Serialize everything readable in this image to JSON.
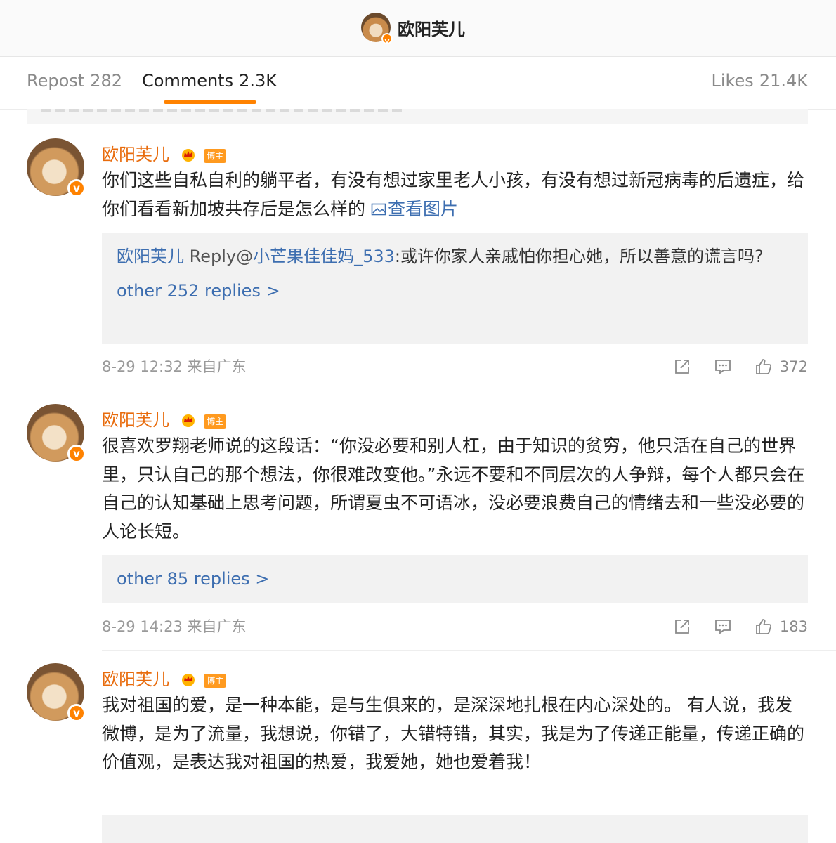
{
  "header": {
    "title": "欧阳芙儿"
  },
  "tabs": {
    "repost_label": "Repost",
    "repost_count": "282",
    "comments_label": "Comments",
    "comments_count": "2.3K",
    "likes_label": "Likes",
    "likes_count": "21.4K"
  },
  "colors": {
    "accent": "#ff8200",
    "username": "#e86b0c",
    "link": "#3d6eb0"
  },
  "badges": {
    "host": "博主"
  },
  "comments": [
    {
      "author": "欧阳芙儿",
      "text": "你们这些自私自利的躺平者，有没有想过家里老人小孩，有没有想过新冠病毒的后遗症，给你们看看新加坡共存后是怎么样的",
      "view_picture": "查看图片",
      "reply": {
        "author": "欧阳芙儿",
        "reply_keyword": "Reply@",
        "target": "小芒果佳佳妈_533",
        "text": ":或许你家人亲戚怕你担心她，所以善意的谎言吗?"
      },
      "more_replies": "other 252 replies >",
      "time": "8-29 12:32",
      "source": "来自广东",
      "likes": "372"
    },
    {
      "author": "欧阳芙儿",
      "text": "很喜欢罗翔老师说的这段话：“你没必要和别人杠，由于知识的贫穷，他只活在自己的世界里，只认自己的那个想法，你很难改变他。”永远不要和不同层次的人争辩，每个人都只会在自己的认知基础上思考问题，所谓夏虫不可语冰，没必要浪费自己的情绪去和一些没必要的人论长短。",
      "more_replies": "other 85 replies >",
      "time": "8-29 14:23",
      "source": "来自广东",
      "likes": "183"
    },
    {
      "author": "欧阳芙儿",
      "text": "我对祖国的爱，是一种本能，是与生俱来的，是深深地扎根在内心深处的。 有人说，我发微博，是为了流量，我想说，你错了，大错特错，其实，我是为了传递正能量，传递正确的价值观，是表达我对祖国的热爱，我爱她，她也爱着我！"
    }
  ]
}
